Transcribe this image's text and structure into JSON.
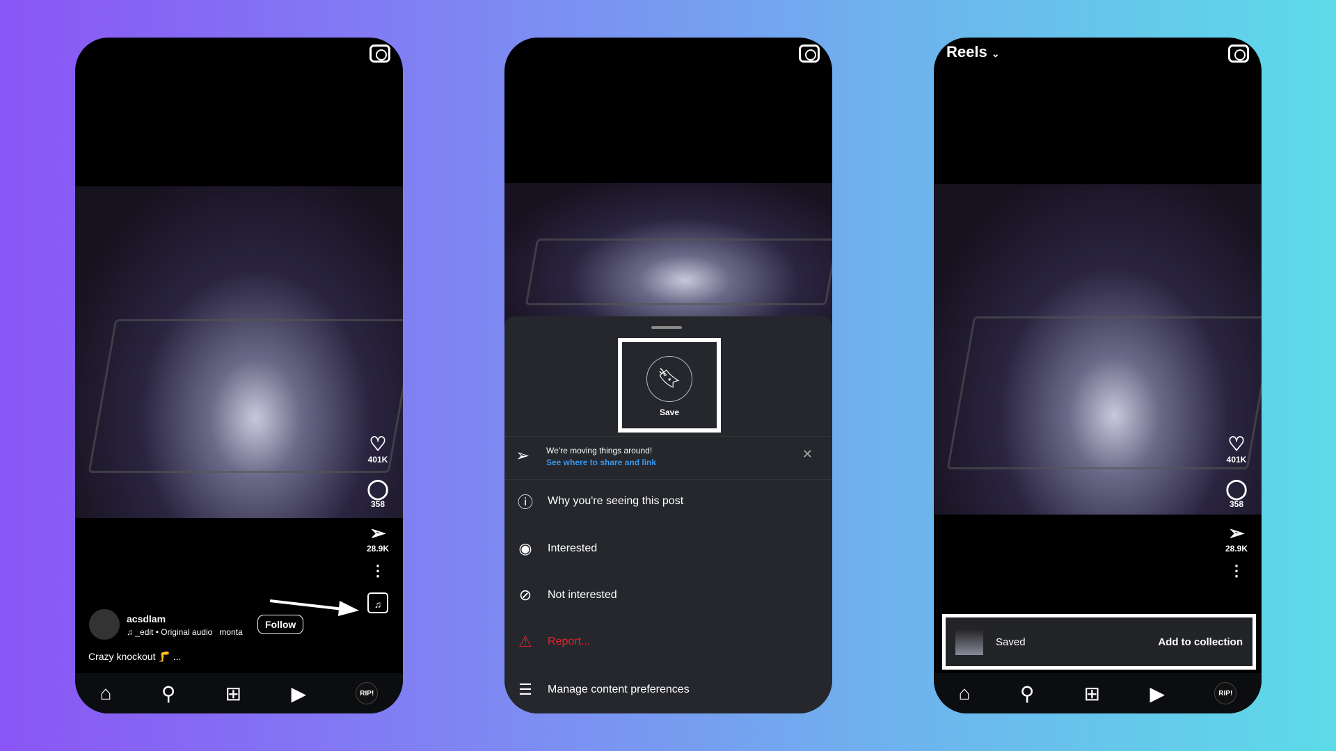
{
  "phone1": {
    "username": "acsdlam",
    "audio": "_edit • Original audio",
    "audio_extra": "monta",
    "follow": "Follow",
    "caption": "Crazy knockout 🦵 ...",
    "likes": "401K",
    "comments": "358",
    "shares": "28.9K",
    "avatar_text": "RIP!"
  },
  "sheet": {
    "save": "Save",
    "notice_title": "We're moving things around!",
    "notice_link": "See where to share and link",
    "items": [
      {
        "label": "Why you're seeing this post",
        "icon": "info-icon"
      },
      {
        "label": "Interested",
        "icon": "eye-icon"
      },
      {
        "label": "Not interested",
        "icon": "eye-off-icon"
      },
      {
        "label": "Report...",
        "icon": "report-icon",
        "color": "#e0242f"
      },
      {
        "label": "Manage content preferences",
        "icon": "sliders-icon"
      }
    ]
  },
  "phone3": {
    "title": "Reels",
    "likes": "401K",
    "comments": "358",
    "shares": "28.9K",
    "saved": "Saved",
    "add_collection": "Add to collection",
    "avatar_text": "RIP!"
  },
  "colors": {
    "link": "#3897f0",
    "report": "#e0242f",
    "sheet": "#25272c"
  }
}
